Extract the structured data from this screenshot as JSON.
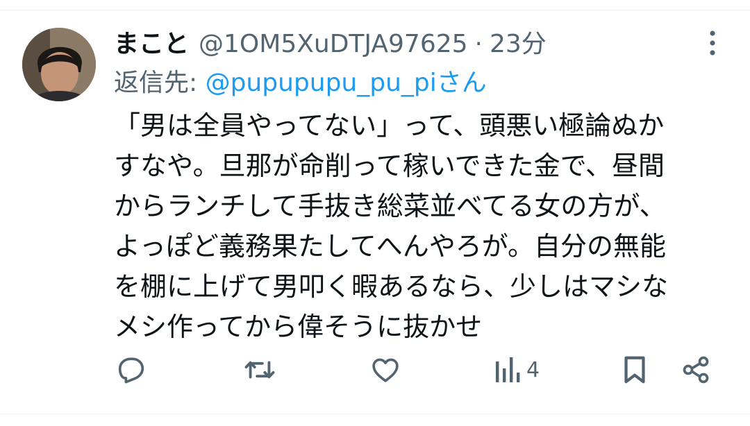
{
  "tweet": {
    "display_name": "まこと",
    "handle": "@1OM5XuDTJA97625",
    "separator": "·",
    "time": "23分",
    "reply_prefix": "返信先: ",
    "reply_to": "@pupupupu_pu_pi",
    "reply_suffix": "さん",
    "body_lines": [
      "「男は全員やってない」って、頭悪い極論ぬか",
      "すなや。旦那が命削って稼いできた金で、昼間",
      "からランチして手抜き総菜並べてる女の方が、",
      "よっぽど義務果たしてへんやろが。自分の無能",
      "を棚に上げて男叩く暇あるなら、少しはマシな",
      "メシ作ってから偉そうに抜かせ"
    ]
  },
  "actions": {
    "reply_icon": "reply-icon",
    "retweet_icon": "retweet-icon",
    "like_icon": "heart-icon",
    "views_icon": "views-icon",
    "views_count": "4",
    "bookmark_icon": "bookmark-icon",
    "share_icon": "share-icon"
  },
  "colors": {
    "text": "#0f1419",
    "secondary": "#536471",
    "link": "#1d9bf0",
    "divider": "#eff3f4"
  }
}
